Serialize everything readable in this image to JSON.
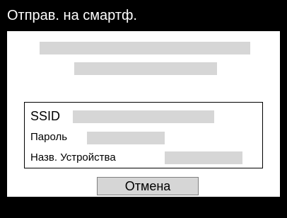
{
  "header": {
    "title": "Отправ. на смартф."
  },
  "info": {
    "ssid_label": "SSID",
    "password_label": "Пароль",
    "device_name_label": "Назв. Устройства"
  },
  "actions": {
    "cancel_label": "Отмена"
  },
  "colors": {
    "background": "#000000",
    "panel": "#ffffff",
    "placeholder": "#d6d6d6"
  }
}
